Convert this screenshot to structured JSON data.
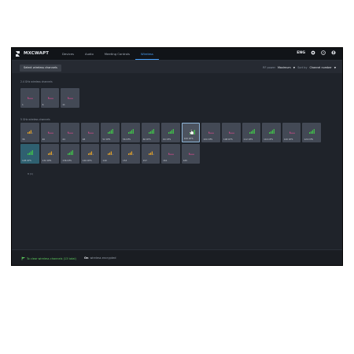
{
  "app": {
    "brand": "MXCWAPT"
  },
  "nav": {
    "tabs": [
      {
        "label": "Devices",
        "active": false
      },
      {
        "label": "Audio",
        "active": false
      },
      {
        "label": "Meeting Controls",
        "active": false
      },
      {
        "label": "Wireless",
        "active": true
      }
    ]
  },
  "topright": {
    "code": "ENG",
    "icons": [
      "settings-icon",
      "help-icon",
      "account-icon"
    ]
  },
  "toolbar": {
    "select_button": "Select wireless channels",
    "rf_power_label": "RF power",
    "rf_power_value": "Maximum",
    "sort_label": "Sort by",
    "sort_value": "Channel number"
  },
  "sections": {
    "ghz24_label": "2.4 GHz wireless channels",
    "ghz5_label": "5 GHz wireless channels"
  },
  "channels_24": [
    {
      "label": "1",
      "signal": "none"
    },
    {
      "label": "6",
      "signal": "none"
    },
    {
      "label": "11",
      "signal": "none"
    }
  ],
  "channels_5": [
    {
      "label": "36",
      "signal": "medium"
    },
    {
      "label": "40",
      "signal": "none"
    },
    {
      "label": "44",
      "signal": "none"
    },
    {
      "label": "48",
      "signal": "none"
    },
    {
      "label": "52   DFS",
      "signal": "strong"
    },
    {
      "label": "56   DFS",
      "signal": "strong"
    },
    {
      "label": "60   DFS",
      "signal": "strong"
    },
    {
      "label": "64   DFS",
      "signal": "strong"
    },
    {
      "label": "100   DFS",
      "signal": "strong",
      "selected": true
    },
    {
      "label": "104   DFS",
      "signal": "none"
    },
    {
      "label": "108   DFS",
      "signal": "none"
    },
    {
      "label": "112   DFS",
      "signal": "strong"
    },
    {
      "label": "116   DFS",
      "signal": "strong"
    },
    {
      "label": "120   DFS",
      "signal": "none"
    },
    {
      "label": "124   DFS",
      "signal": "strong"
    },
    {
      "label": "128   DFS",
      "signal": "strong",
      "teal": true
    },
    {
      "label": "132   DFS",
      "signal": "medium"
    },
    {
      "label": "136   DFS",
      "signal": "strong"
    },
    {
      "label": "140   DFS",
      "signal": "medium"
    },
    {
      "label": "149",
      "signal": "medium"
    },
    {
      "label": "153",
      "signal": "medium"
    },
    {
      "label": "157",
      "signal": "medium"
    },
    {
      "label": "161",
      "signal": "none"
    },
    {
      "label": "165",
      "signal": "none"
    }
  ],
  "selected_note": "8 (1)",
  "footer": {
    "channels_text": "To clear wireless channels (13 total)",
    "encryption_on": "On",
    "encryption_text": "wireless encrypted"
  },
  "colors": {
    "accent": "#4aa3ff",
    "strong": "#41c74a",
    "medium": "#e0a12a",
    "none": "#d04a8c"
  }
}
